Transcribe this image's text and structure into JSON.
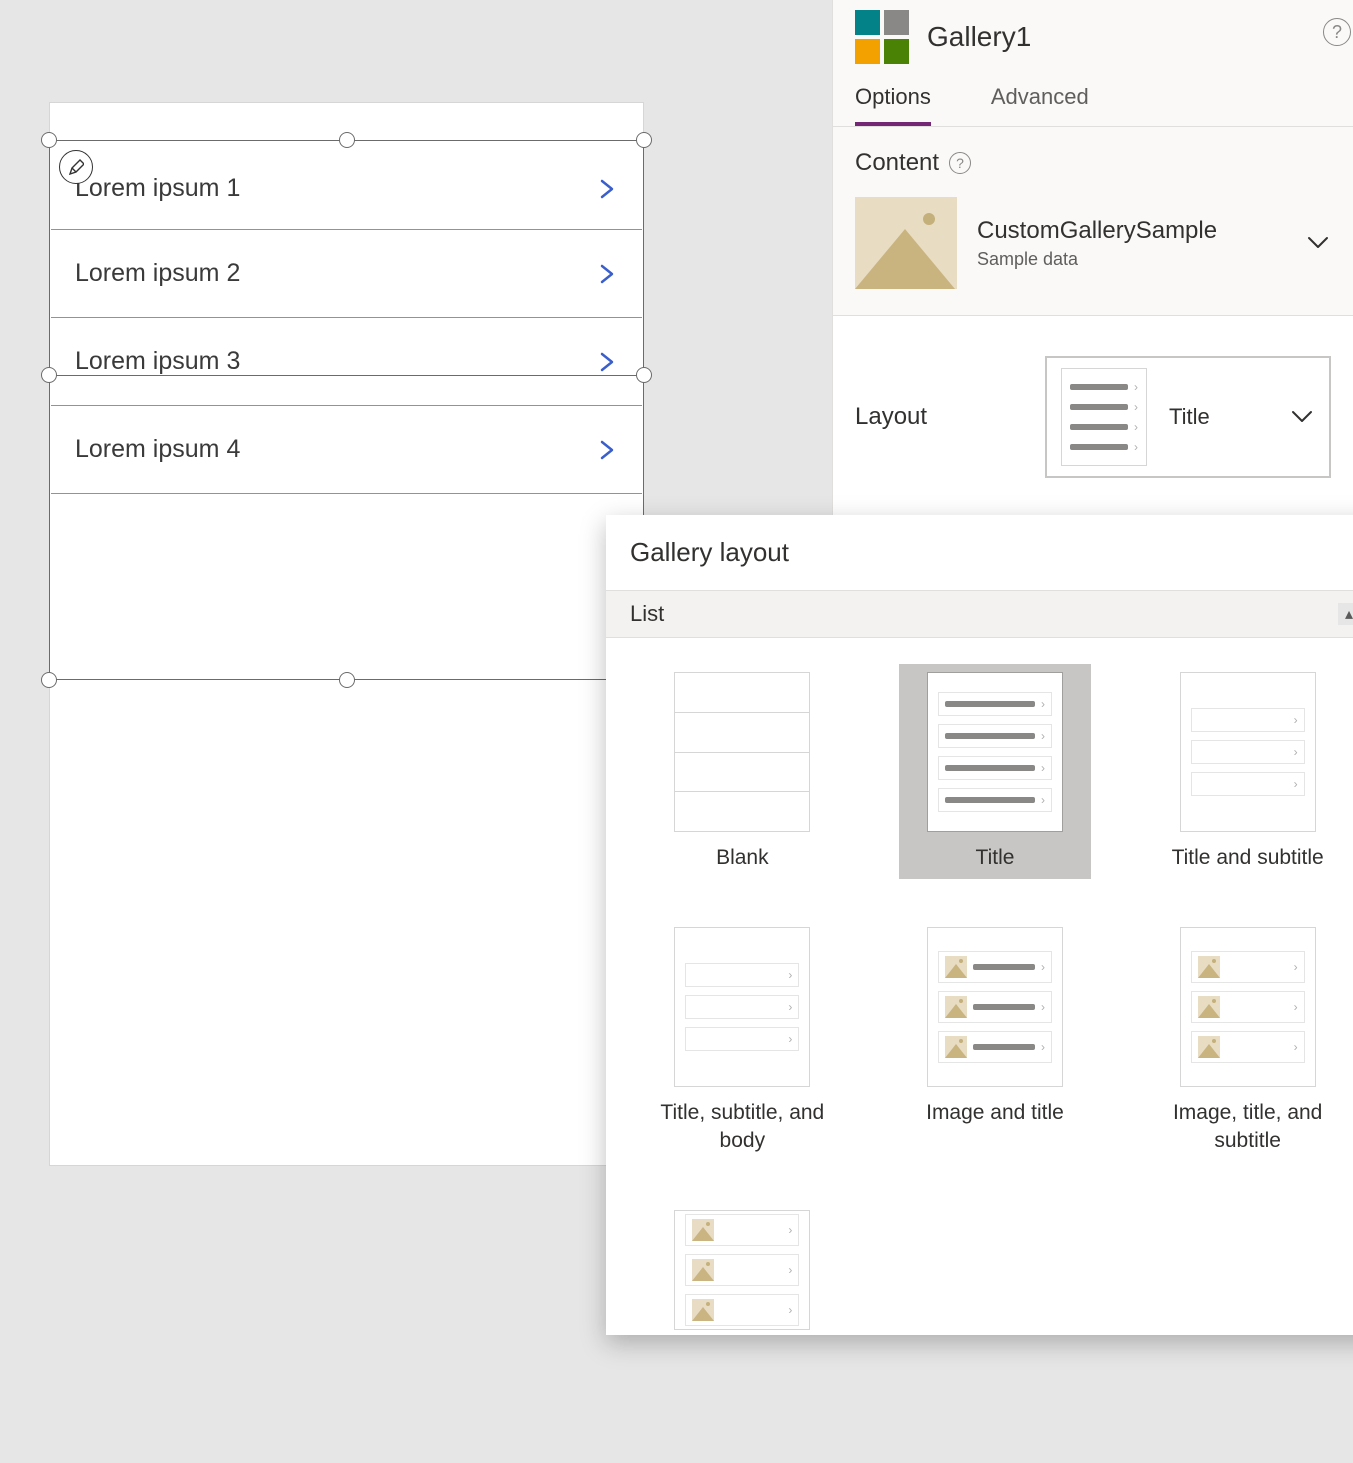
{
  "canvas": {
    "gallery": {
      "items": [
        {
          "title": "Lorem ipsum 1"
        },
        {
          "title": "Lorem ipsum 2"
        },
        {
          "title": "Lorem ipsum 3"
        },
        {
          "title": "Lorem ipsum 4"
        }
      ]
    }
  },
  "pane": {
    "title": "Gallery1",
    "tabs": {
      "options": "Options",
      "advanced": "Advanced",
      "active": "options"
    },
    "content": {
      "heading": "Content",
      "datasource_name": "CustomGallerySample",
      "datasource_hint": "Sample data"
    },
    "layout": {
      "label": "Layout",
      "selected": "Title"
    }
  },
  "popup": {
    "title": "Gallery layout",
    "section": "List",
    "options": [
      {
        "key": "blank",
        "label": "Blank"
      },
      {
        "key": "title",
        "label": "Title",
        "selected": true
      },
      {
        "key": "title_subtitle",
        "label": "Title and subtitle"
      },
      {
        "key": "title_subtitle_body",
        "label": "Title, subtitle, and body"
      },
      {
        "key": "image_title",
        "label": "Image and title"
      },
      {
        "key": "image_title_subtitle",
        "label": "Image, title, and subtitle"
      }
    ]
  }
}
